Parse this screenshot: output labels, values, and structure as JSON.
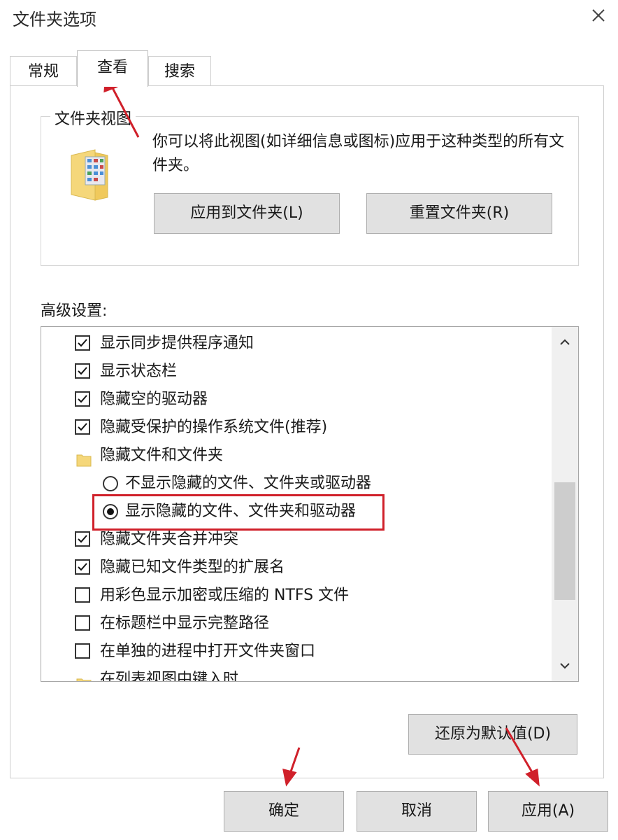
{
  "window": {
    "title": "文件夹选项",
    "close_icon": "close-icon"
  },
  "tabs": [
    {
      "label": "常规",
      "selected": false
    },
    {
      "label": "查看",
      "selected": true
    },
    {
      "label": "搜索",
      "selected": false
    }
  ],
  "folder_views": {
    "title": "文件夹视图",
    "icon": "folder-view-icon",
    "description": "你可以将此视图(如详细信息或图标)应用于这种类型的所有文件夹。",
    "apply_button": "应用到文件夹(L)",
    "reset_button": "重置文件夹(R)"
  },
  "advanced": {
    "label": "高级设置:",
    "items": [
      {
        "type": "checkbox",
        "label": "显示同步提供程序通知",
        "checked": true
      },
      {
        "type": "checkbox",
        "label": "显示状态栏",
        "checked": true
      },
      {
        "type": "checkbox",
        "label": "隐藏空的驱动器",
        "checked": true
      },
      {
        "type": "checkbox",
        "label": "隐藏受保护的操作系统文件(推荐)",
        "checked": true
      },
      {
        "type": "folder",
        "label": "隐藏文件和文件夹"
      },
      {
        "type": "radio",
        "label": "不显示隐藏的文件、文件夹或驱动器",
        "checked": false
      },
      {
        "type": "radio",
        "label": "显示隐藏的文件、文件夹和驱动器",
        "checked": true
      },
      {
        "type": "checkbox",
        "label": "隐藏文件夹合并冲突",
        "checked": true
      },
      {
        "type": "checkbox",
        "label": "隐藏已知文件类型的扩展名",
        "checked": true
      },
      {
        "type": "checkbox",
        "label": "用彩色显示加密或压缩的 NTFS 文件",
        "checked": false
      },
      {
        "type": "checkbox",
        "label": "在标题栏中显示完整路径",
        "checked": false
      },
      {
        "type": "checkbox",
        "label": "在单独的进程中打开文件夹窗口",
        "checked": false
      },
      {
        "type": "folder",
        "label": "在列表视图中键入时"
      }
    ],
    "restore_button": "还原为默认值(D)"
  },
  "footer": {
    "ok": "确定",
    "cancel": "取消",
    "apply": "应用(A)"
  },
  "colors": {
    "annotation": "#d0202a",
    "button_bg": "#e1e1e1",
    "folder": "#f5d77a"
  }
}
